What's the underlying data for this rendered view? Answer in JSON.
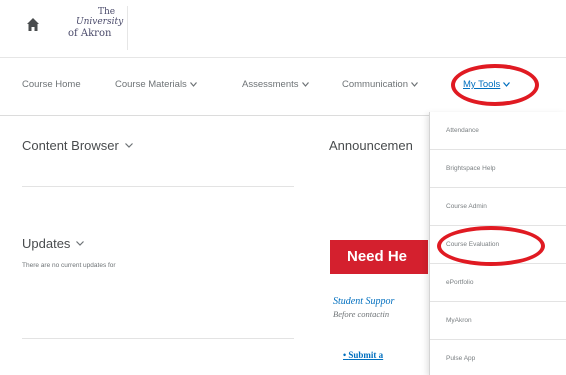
{
  "header": {
    "home_icon": "home-icon",
    "logo": {
      "line1": "The",
      "line2": "University",
      "line3": "of Akron"
    }
  },
  "nav": {
    "items": [
      {
        "label": "Course Home",
        "has_menu": false
      },
      {
        "label": "Course Materials",
        "has_menu": true
      },
      {
        "label": "Assessments",
        "has_menu": true
      },
      {
        "label": "Communication",
        "has_menu": true
      },
      {
        "label": "My Tools",
        "has_menu": true,
        "active": true
      }
    ]
  },
  "main": {
    "content_browser": {
      "title": "Content Browser"
    },
    "announcements": {
      "title": "Announcemen"
    },
    "updates": {
      "title": "Updates",
      "empty_text": "There are no current updates for"
    },
    "need_help": {
      "label": "Need He"
    },
    "student_support": {
      "title": "Student Suppor",
      "subtitle": "Before contactin"
    },
    "submit_link": "Submit a"
  },
  "dropdown": {
    "items": [
      "Attendance",
      "Brightspace Help",
      "Course Admin",
      "Course Evaluation",
      "ePortfolio",
      "MyAkron",
      "Pulse App"
    ]
  },
  "annotations": {
    "color": "#e01a22",
    "circled": [
      "My Tools",
      "Course Evaluation"
    ]
  },
  "colors": {
    "link": "#006fbf",
    "need_help_bg": "#d4202e",
    "text": "#494c4e"
  }
}
